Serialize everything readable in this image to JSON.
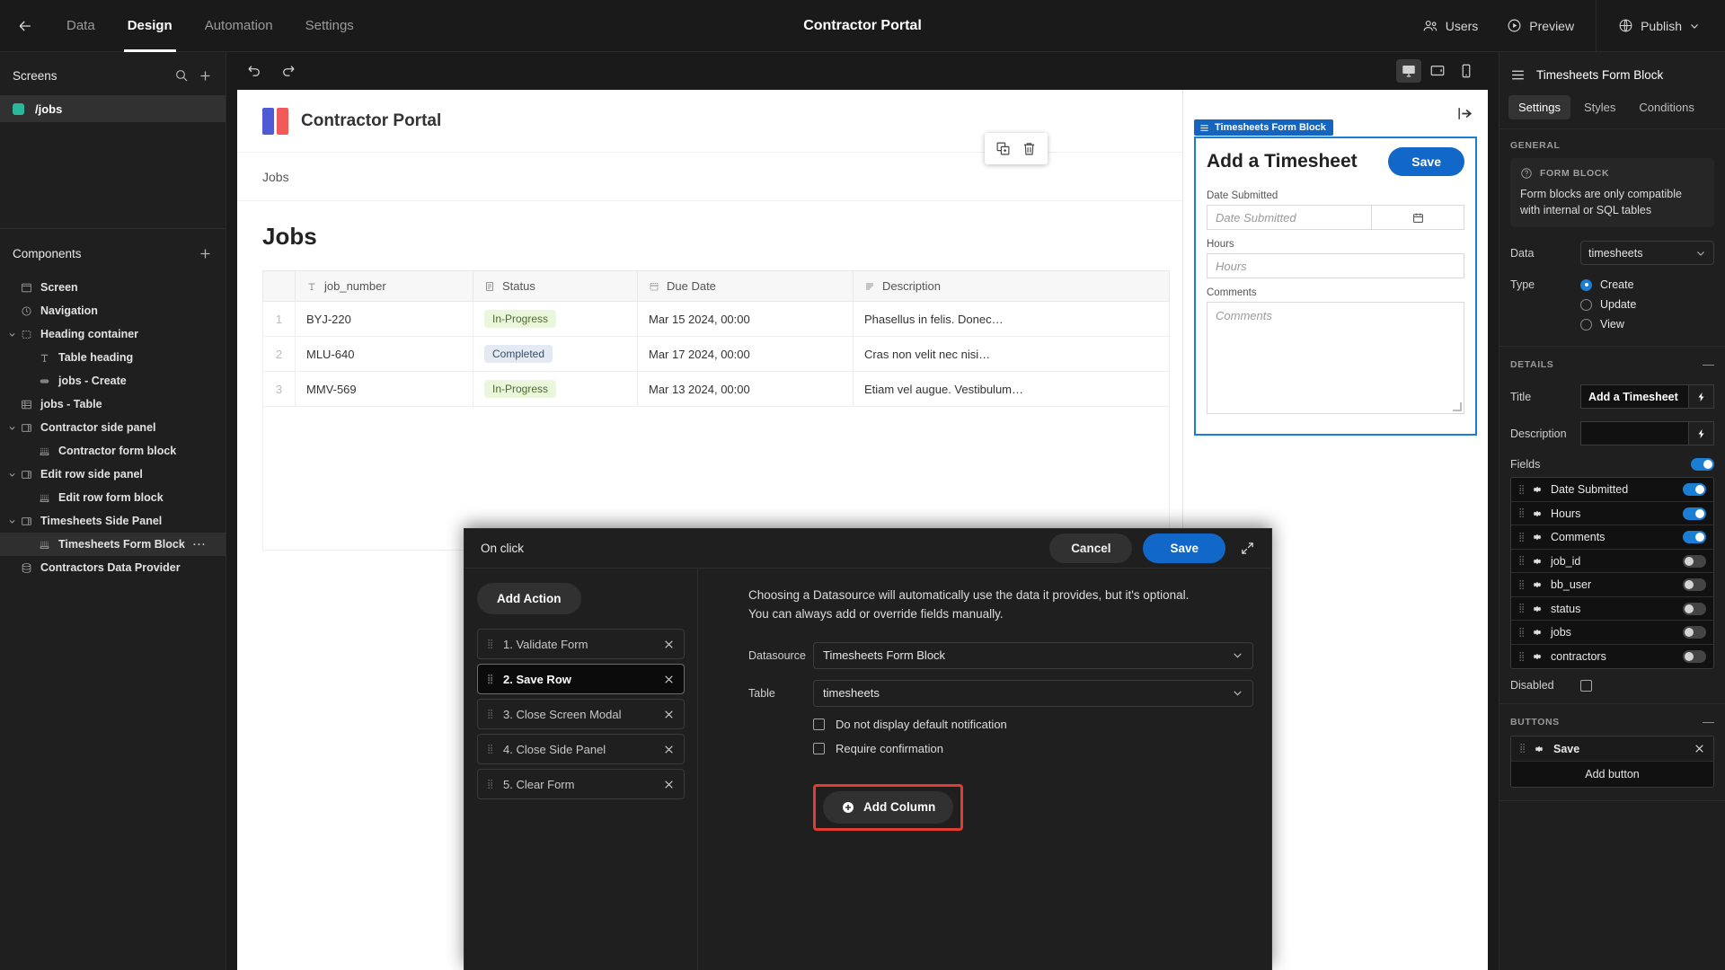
{
  "topbar": {
    "back_icon": "arrow-left-icon",
    "tabs": [
      {
        "label": "Data",
        "active": false
      },
      {
        "label": "Design",
        "active": true
      },
      {
        "label": "Automation",
        "active": false
      },
      {
        "label": "Settings",
        "active": false
      }
    ],
    "app_title": "Contractor Portal",
    "users_label": "Users",
    "preview_label": "Preview",
    "publish_label": "Publish"
  },
  "left_panel": {
    "screens_title": "Screens",
    "screens": [
      {
        "label": "/jobs",
        "active": true
      }
    ],
    "components_title": "Components",
    "tree": [
      {
        "label": "Screen",
        "icon": "screen-icon",
        "depth": 0,
        "caret": false,
        "selected": false
      },
      {
        "label": "Navigation",
        "icon": "navigation-icon",
        "depth": 0,
        "caret": false,
        "selected": false
      },
      {
        "label": "Heading container",
        "icon": "container-icon",
        "depth": 0,
        "caret": true,
        "selected": false
      },
      {
        "label": "Table heading",
        "icon": "text-icon",
        "depth": 1,
        "caret": false,
        "selected": false
      },
      {
        "label": "jobs - Create",
        "icon": "button-icon",
        "depth": 1,
        "caret": false,
        "selected": false
      },
      {
        "label": "jobs - Table",
        "icon": "table-icon",
        "depth": 0,
        "caret": false,
        "selected": false
      },
      {
        "label": "Contractor side panel",
        "icon": "side-panel-icon",
        "depth": 0,
        "caret": true,
        "selected": false
      },
      {
        "label": "Contractor form block",
        "icon": "form-block-icon",
        "depth": 1,
        "caret": false,
        "selected": false
      },
      {
        "label": "Edit row side panel",
        "icon": "side-panel-icon",
        "depth": 0,
        "caret": true,
        "selected": false
      },
      {
        "label": "Edit row form block",
        "icon": "form-block-icon",
        "depth": 1,
        "caret": false,
        "selected": false
      },
      {
        "label": "Timesheets Side Panel",
        "icon": "side-panel-icon",
        "depth": 0,
        "caret": true,
        "selected": false
      },
      {
        "label": "Timesheets Form Block",
        "icon": "form-block-icon",
        "depth": 1,
        "caret": false,
        "selected": true,
        "more": "···"
      },
      {
        "label": "Contractors Data Provider",
        "icon": "database-icon",
        "depth": 0,
        "caret": false,
        "selected": false
      }
    ]
  },
  "canvas": {
    "undo_icon": "undo-icon",
    "redo_icon": "redo-icon",
    "devices": [
      {
        "name": "desktop-icon",
        "active": true
      },
      {
        "name": "tablet-icon",
        "active": false
      },
      {
        "name": "mobile-icon",
        "active": false
      }
    ],
    "preview": {
      "brand": "Contractor Portal",
      "nav_links": [
        "Jobs"
      ],
      "page_title": "Jobs",
      "table": {
        "columns": [
          {
            "label": "job_number",
            "icon": "text-type-icon"
          },
          {
            "label": "Status",
            "icon": "options-type-icon"
          },
          {
            "label": "Due Date",
            "icon": "date-type-icon"
          },
          {
            "label": "Description",
            "icon": "longform-type-icon"
          }
        ],
        "rows": [
          {
            "index": "1",
            "job_number": "BYJ-220",
            "status": "In-Progress",
            "status_style": "green",
            "due_date": "Mar 15 2024, 00:00",
            "description": "Phasellus in felis. Donec…"
          },
          {
            "index": "2",
            "job_number": "MLU-640",
            "status": "Completed",
            "status_style": "blue",
            "due_date": "Mar 17 2024, 00:00",
            "description": "Cras non velit nec nisi…"
          },
          {
            "index": "3",
            "job_number": "MMV-569",
            "status": "In-Progress",
            "status_style": "green",
            "due_date": "Mar 13 2024, 00:00",
            "description": "Etiam vel augue. Vestibulum…"
          }
        ]
      }
    },
    "side_panel": {
      "collapse_icon": "collapse-panel-icon",
      "float_tools": [
        {
          "name": "duplicate-icon"
        },
        {
          "name": "delete-icon"
        }
      ],
      "block_tag": "Timesheets Form Block",
      "form_title": "Add a Timesheet",
      "save_label": "Save",
      "fields": [
        {
          "label": "Date Submitted",
          "placeholder": "Date Submitted",
          "type": "date"
        },
        {
          "label": "Hours",
          "placeholder": "Hours",
          "type": "text"
        },
        {
          "label": "Comments",
          "placeholder": "Comments",
          "type": "textarea"
        }
      ]
    }
  },
  "drawer": {
    "title": "On click",
    "cancel_label": "Cancel",
    "save_label": "Save",
    "expand_icon": "expand-icon",
    "add_action_label": "Add Action",
    "actions": [
      {
        "label": "1. Validate Form",
        "selected": false
      },
      {
        "label": "2. Save Row",
        "selected": true
      },
      {
        "label": "3. Close Screen Modal",
        "selected": false
      },
      {
        "label": "4. Close Side Panel",
        "selected": false
      },
      {
        "label": "5. Clear Form",
        "selected": false
      }
    ],
    "description_line1": "Choosing a Datasource will automatically use the data it provides, but it's optional.",
    "description_line2": "You can always add or override fields manually.",
    "datasource_label": "Datasource",
    "datasource_value": "Timesheets Form Block",
    "table_label": "Table",
    "table_value": "timesheets",
    "checkbox_1": "Do not display default notification",
    "checkbox_2": "Require confirmation",
    "add_column_label": "Add Column",
    "highlight_color": "#e03c31"
  },
  "right_panel": {
    "menu_icon": "panel-menu-icon",
    "component_name": "Timesheets Form Block",
    "tabs": [
      {
        "label": "Settings",
        "active": true
      },
      {
        "label": "Styles",
        "active": false
      },
      {
        "label": "Conditions",
        "active": false
      }
    ],
    "general_header": "GENERAL",
    "notice": {
      "icon": "help-icon",
      "title": "FORM BLOCK",
      "text": "Form blocks are only compatible with internal or SQL tables"
    },
    "data_label": "Data",
    "data_value": "timesheets",
    "type_label": "Type",
    "type_options": [
      {
        "label": "Create",
        "selected": true
      },
      {
        "label": "Update",
        "selected": false
      },
      {
        "label": "View",
        "selected": false
      }
    ],
    "details_header": "DETAILS",
    "details_collapse": "—",
    "title_label": "Title",
    "title_value": "Add a Timesheet",
    "description_label": "Description",
    "description_value": "",
    "fields_label": "Fields",
    "fields_toggle": true,
    "fields": [
      {
        "label": "Date Submitted",
        "enabled": true
      },
      {
        "label": "Hours",
        "enabled": true
      },
      {
        "label": "Comments",
        "enabled": true
      },
      {
        "label": "job_id",
        "enabled": false
      },
      {
        "label": "bb_user",
        "enabled": false
      },
      {
        "label": "status",
        "enabled": false
      },
      {
        "label": "jobs",
        "enabled": false
      },
      {
        "label": "contractors",
        "enabled": false
      }
    ],
    "disabled_label": "Disabled",
    "buttons_header": "BUTTONS",
    "buttons_collapse": "—",
    "buttons": [
      {
        "label": "Save"
      }
    ],
    "add_button_label": "Add button"
  }
}
